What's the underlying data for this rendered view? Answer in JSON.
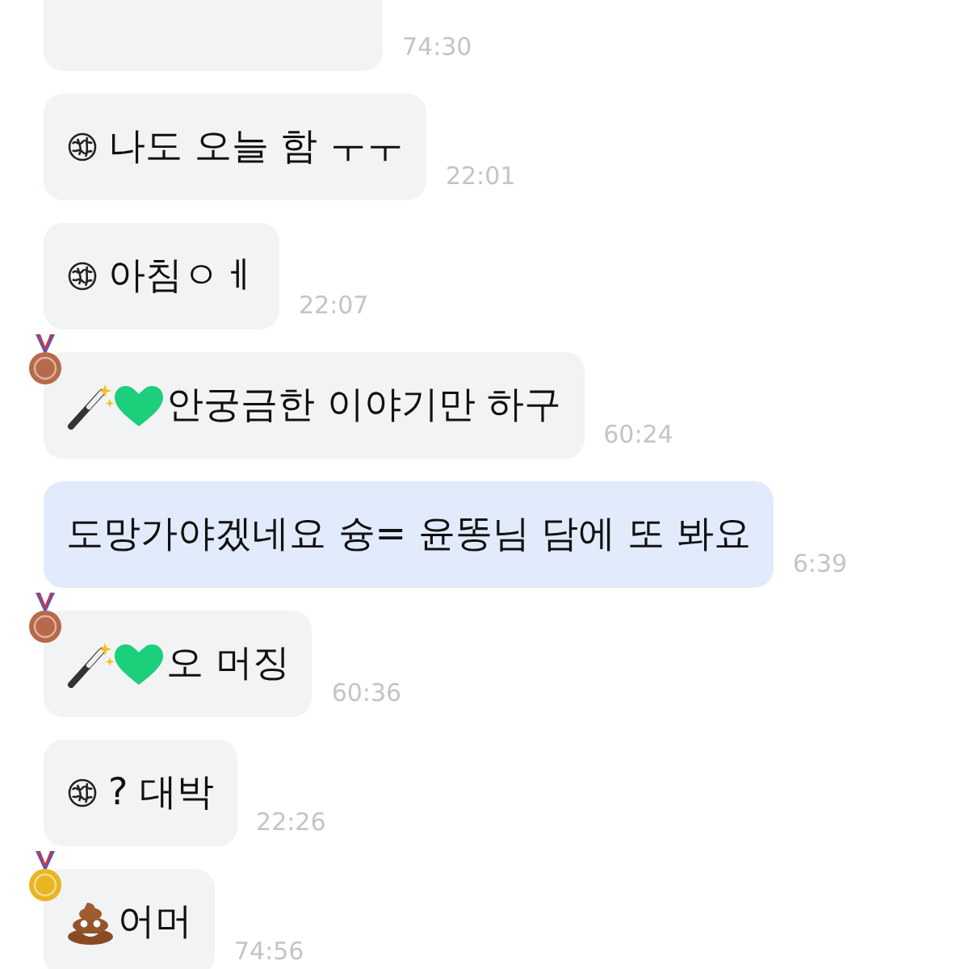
{
  "messages": [
    {
      "kind": "other",
      "time": "74:30"
    },
    {
      "kind": "other",
      "icon": {
        "kind": "scribble"
      },
      "text": "나도 오늘 함 ㅜㅜ",
      "time": "22:01"
    },
    {
      "kind": "other",
      "icon": {
        "kind": "scribble"
      },
      "text": "아침ㅇㅔ",
      "time": "22:07"
    },
    {
      "kind": "other",
      "badge": {
        "kind": "bronze"
      },
      "icon": {
        "kind": "wand-heart"
      },
      "text": "안궁금한 이야기만 하구",
      "time": "60:24"
    },
    {
      "kind": "mine",
      "text": "도망가야겠네요 슝= 윤똥님 담에 또 봐요",
      "time": "6:39"
    },
    {
      "kind": "other",
      "badge": {
        "kind": "bronze"
      },
      "icon": {
        "kind": "wand-heart"
      },
      "text": "오 머징",
      "time": "60:36"
    },
    {
      "kind": "other",
      "icon": {
        "kind": "scribble"
      },
      "text": "? 대박",
      "time": "22:26"
    },
    {
      "kind": "other",
      "badge": {
        "kind": "gold"
      },
      "icon": {
        "kind": "poop"
      },
      "text": "어머",
      "time": "74:56"
    }
  ]
}
